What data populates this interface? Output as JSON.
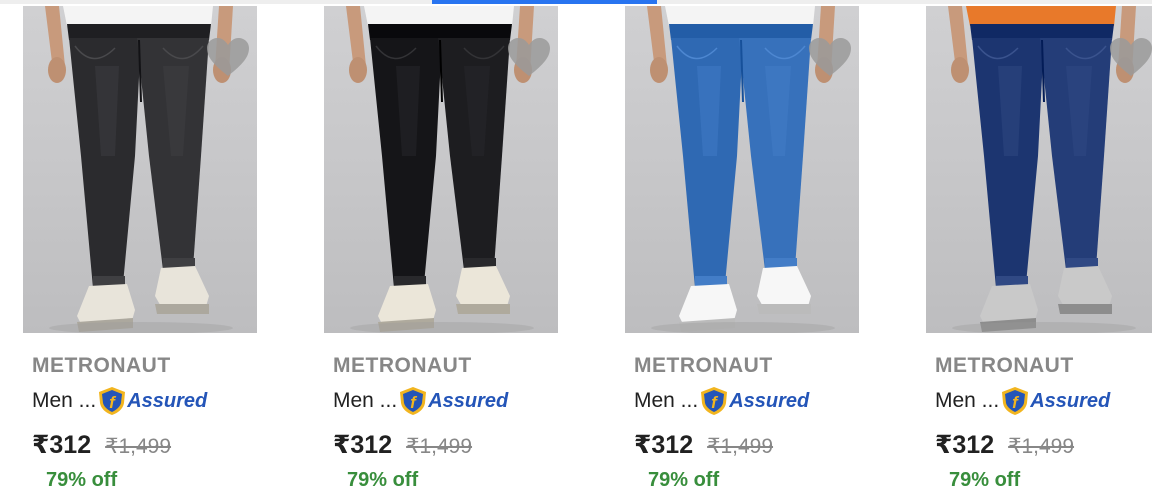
{
  "products": [
    {
      "brand": "METRONAUT",
      "name": "Men ...",
      "assured_label": "Assured",
      "price": "₹312",
      "mrp": "₹1,499",
      "discount": "79% off",
      "colors": {
        "top": "#f4f4f4",
        "jeans": "#2b2b2e",
        "shoe": "#e8e4da"
      }
    },
    {
      "brand": "METRONAUT",
      "name": "Men ...",
      "assured_label": "Assured",
      "price": "₹312",
      "mrp": "₹1,499",
      "discount": "79% off",
      "colors": {
        "top": "#f4f4f4",
        "jeans": "#151518",
        "shoe": "#ebe6d9"
      }
    },
    {
      "brand": "METRONAUT",
      "name": "Men ...",
      "assured_label": "Assured",
      "price": "₹312",
      "mrp": "₹1,499",
      "discount": "79% off",
      "colors": {
        "top": "#f4f4f4",
        "jeans": "#2f69b3",
        "shoe": "#f7f7f7"
      }
    },
    {
      "brand": "METRONAUT",
      "name": "Men ...",
      "assured_label": "Assured",
      "price": "₹312",
      "mrp": "₹1,499",
      "discount": "79% off",
      "colors": {
        "top": "#e8792a",
        "jeans": "#1c3570",
        "shoe": "#c9c9c9"
      }
    }
  ],
  "icons": {
    "wishlist": "heart-icon",
    "assured": "assured-shield-icon"
  },
  "theme": {
    "accent": "#2874f0",
    "discount_green": "#388e3c",
    "assured_blue": "#2455b8",
    "assured_gold": "#f2b51f"
  }
}
